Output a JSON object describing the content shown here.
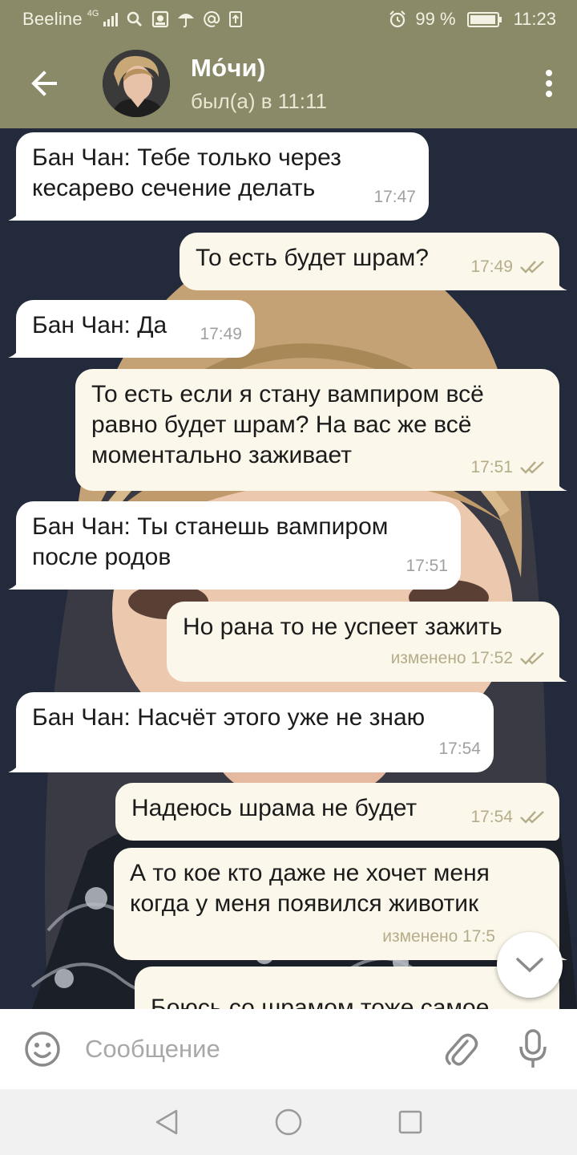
{
  "status_bar": {
    "carrier": "Beeline",
    "network": "4G",
    "battery": "99 %",
    "battery_level": 0.99,
    "time": "11:23",
    "icons": [
      "signal-icon",
      "search-icon",
      "image-icon",
      "umbrella-icon",
      "at-icon",
      "upload-icon",
      "alarm-icon",
      "battery-icon"
    ]
  },
  "header": {
    "title": "Мо́чи)",
    "status": "был(а) в 11:11",
    "icons": [
      "back-arrow-icon",
      "avatar",
      "more-vert-icon"
    ]
  },
  "messages": [
    {
      "dir": "in",
      "text": "Бан Чан: Тебе только через кесарево сечение делать",
      "time": "17:47"
    },
    {
      "dir": "out",
      "text": "То есть будет шрам?",
      "time": "17:49",
      "read": true
    },
    {
      "dir": "in",
      "text": "Бан Чан: Да",
      "time": "17:49"
    },
    {
      "dir": "out",
      "text": "То есть если я стану вампиром всё равно будет шрам? На вас же всё моментально заживает",
      "time": "17:51",
      "read": true
    },
    {
      "dir": "in",
      "text": "Бан Чан: Ты станешь вампиром после родов",
      "time": "17:51"
    },
    {
      "dir": "out",
      "text": "Но рана то не успеет зажить",
      "time": "изменено 17:52",
      "read": true
    },
    {
      "dir": "in",
      "text": "Бан Чан: Насчёт этого уже не знаю",
      "time": "17:54"
    },
    {
      "dir": "out",
      "text": "Надеюсь шрама не будет",
      "time": "17:54",
      "read": true
    },
    {
      "dir": "out",
      "text": "А то кое кто даже не хочет меня когда у меня появился животик",
      "time": "изменено 17:5",
      "read": false
    },
    {
      "dir": "out",
      "text": "Боюсь со шрамом тоже самое",
      "time": "",
      "read": false
    }
  ],
  "input": {
    "placeholder": "Сообщение",
    "value": ""
  },
  "colors": {
    "header": "#8b8a68",
    "incoming_bubble": "#ffffff",
    "outgoing_bubble": "#fbf7ea",
    "check": "#b5ad8a",
    "nav_bar": "#f1f1f1"
  },
  "nav": [
    "back-triangle-icon",
    "home-circle-icon",
    "recents-square-icon"
  ]
}
